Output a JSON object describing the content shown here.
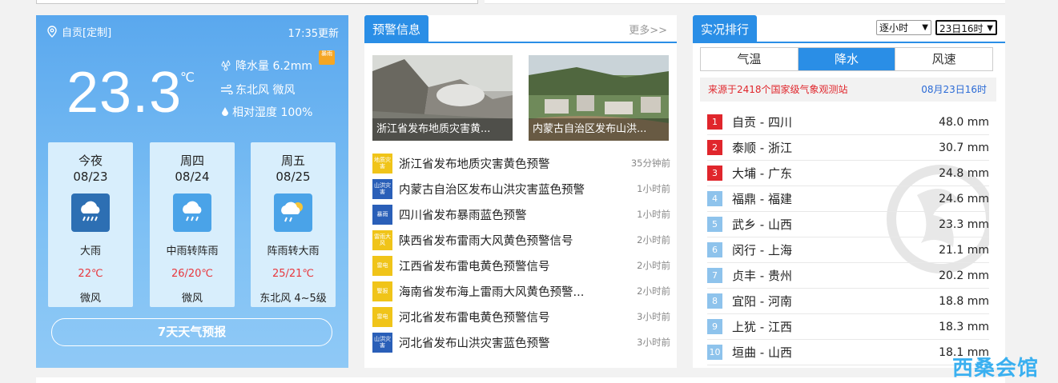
{
  "current": {
    "location": "自贡[定制]",
    "update_time": "17:35更新",
    "temperature": "23.3",
    "unit": "℃",
    "precip": "降水量 6.2mm",
    "wind": "东北风 微风",
    "humidity": "相对湿度 100%",
    "badge": "暴雨",
    "forecast": [
      {
        "day": "今夜",
        "date": "08/23",
        "desc": "大雨",
        "temp": "22℃",
        "wind": "微风",
        "icon": "heavy-rain-icon"
      },
      {
        "day": "周四",
        "date": "08/24",
        "desc": "中雨转阵雨",
        "temp": "26/20℃",
        "wind": "微风",
        "icon": "rain-icon"
      },
      {
        "day": "周五",
        "date": "08/25",
        "desc": "阵雨转大雨",
        "temp": "25/21℃",
        "wind": "东北风 4~5级",
        "icon": "shower-sun-icon"
      }
    ],
    "forecast_button": "7天天气预报"
  },
  "warnings": {
    "title": "预警信息",
    "more": "更多>>",
    "pictures": [
      {
        "caption": "浙江省发布地质灾害黄..."
      },
      {
        "caption": "内蒙古自治区发布山洪..."
      }
    ],
    "items": [
      {
        "text": "浙江省发布地质灾害黄色预警",
        "time": "35分钟前",
        "color": "#f0c419",
        "icon": "地质灾害"
      },
      {
        "text": "内蒙古自治区发布山洪灾害蓝色预警",
        "time": "1小时前",
        "color": "#2a5fb8",
        "icon": "山洪灾害"
      },
      {
        "text": "四川省发布暴雨蓝色预警",
        "time": "1小时前",
        "color": "#2a5fb8",
        "icon": "暴雨"
      },
      {
        "text": "陕西省发布雷雨大风黄色预警信号",
        "time": "2小时前",
        "color": "#f0c419",
        "icon": "雷雨大风"
      },
      {
        "text": "江西省发布雷电黄色预警信号",
        "time": "2小时前",
        "color": "#f0c419",
        "icon": "雷电"
      },
      {
        "text": "海南省发布海上雷雨大风黄色预警...",
        "time": "2小时前",
        "color": "#f0c419",
        "icon": "警报"
      },
      {
        "text": "河北省发布雷电黄色预警信号",
        "time": "3小时前",
        "color": "#f0c419",
        "icon": "雷电"
      },
      {
        "text": "河北省发布山洪灾害蓝色预警",
        "time": "3小时前",
        "color": "#2a5fb8",
        "icon": "山洪灾害"
      }
    ]
  },
  "ranking": {
    "title": "实况排行",
    "select_mode": "逐小时",
    "select_time": "23日16时",
    "tabs": [
      "气温",
      "降水",
      "风速"
    ],
    "active_tab": "降水",
    "source": "来源于2418个国家级气象观测站",
    "source_time": "08月23日16时",
    "rows": [
      {
        "rank": "1",
        "city": "自贡 - 四川",
        "value": "48.0 mm"
      },
      {
        "rank": "2",
        "city": "泰顺 - 浙江",
        "value": "30.7 mm"
      },
      {
        "rank": "3",
        "city": "大埔 - 广东",
        "value": "24.8 mm"
      },
      {
        "rank": "4",
        "city": "福鼎 - 福建",
        "value": "24.6 mm"
      },
      {
        "rank": "5",
        "city": "武乡 - 山西",
        "value": "23.3 mm"
      },
      {
        "rank": "6",
        "city": "闵行 - 上海",
        "value": "21.1 mm"
      },
      {
        "rank": "7",
        "city": "贞丰 - 贵州",
        "value": "20.2 mm"
      },
      {
        "rank": "8",
        "city": "宜阳 - 河南",
        "value": "18.8 mm"
      },
      {
        "rank": "9",
        "city": "上犹 - 江西",
        "value": "18.3 mm"
      },
      {
        "rank": "10",
        "city": "垣曲 - 山西",
        "value": "18.1 mm"
      }
    ],
    "top_color": "#e0262c",
    "other_color": "#8ec3ec"
  },
  "watermark": "西桑会馆"
}
